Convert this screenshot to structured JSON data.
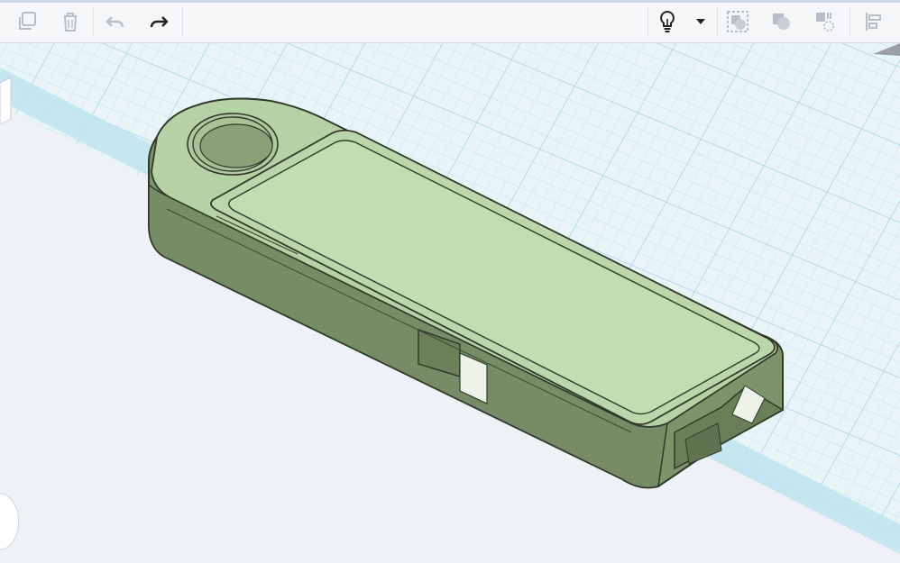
{
  "toolbar": {
    "left_tools": [
      {
        "name": "copy-icon",
        "enabled": false
      },
      {
        "name": "trash-icon",
        "enabled": false
      },
      {
        "name": "undo-icon",
        "enabled": false
      },
      {
        "name": "redo-icon",
        "enabled": true
      }
    ],
    "right_tools": [
      {
        "name": "lightbulb-icon",
        "enabled": true
      },
      {
        "name": "dropdown-caret-icon",
        "enabled": true
      },
      {
        "name": "group-icon",
        "enabled": false
      },
      {
        "name": "ungroup-icon",
        "enabled": false
      },
      {
        "name": "mirror-icon",
        "enabled": false
      },
      {
        "name": "align-icon",
        "enabled": false
      }
    ]
  },
  "workplane": {
    "grid_color": "#a9d7e4",
    "background_color": "#eef1f5",
    "model_color": "#b6d1a5"
  }
}
